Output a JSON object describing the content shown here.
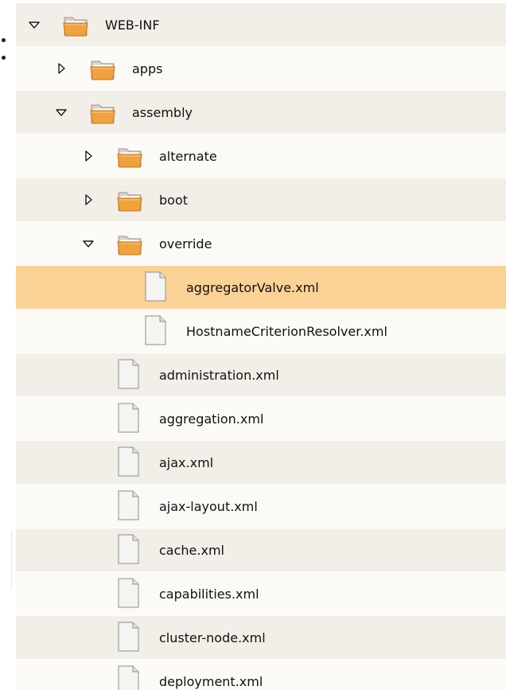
{
  "colors": {
    "row_odd": "#f2efe8",
    "row_even": "#fbfaf7",
    "row_selected": "#fbd296",
    "folder": "#f0a23c",
    "text": "#111111"
  },
  "tree": {
    "items": [
      {
        "label": "WEB-INF",
        "depth": 0,
        "type": "folder",
        "state": "expanded"
      },
      {
        "label": "apps",
        "depth": 1,
        "type": "folder",
        "state": "collapsed"
      },
      {
        "label": "assembly",
        "depth": 1,
        "type": "folder",
        "state": "expanded"
      },
      {
        "label": "alternate",
        "depth": 2,
        "type": "folder",
        "state": "collapsed"
      },
      {
        "label": "boot",
        "depth": 2,
        "type": "folder",
        "state": "collapsed"
      },
      {
        "label": "override",
        "depth": 2,
        "type": "folder",
        "state": "expanded"
      },
      {
        "label": "aggregatorValve.xml",
        "depth": 3,
        "type": "file",
        "selected": true
      },
      {
        "label": "HostnameCriterionResolver.xml",
        "depth": 3,
        "type": "file"
      },
      {
        "label": "administration.xml",
        "depth": 2,
        "type": "file"
      },
      {
        "label": "aggregation.xml",
        "depth": 2,
        "type": "file"
      },
      {
        "label": "ajax.xml",
        "depth": 2,
        "type": "file"
      },
      {
        "label": "ajax-layout.xml",
        "depth": 2,
        "type": "file"
      },
      {
        "label": "cache.xml",
        "depth": 2,
        "type": "file"
      },
      {
        "label": "capabilities.xml",
        "depth": 2,
        "type": "file"
      },
      {
        "label": "cluster-node.xml",
        "depth": 2,
        "type": "file"
      },
      {
        "label": "deployment.xml",
        "depth": 2,
        "type": "file"
      }
    ]
  }
}
